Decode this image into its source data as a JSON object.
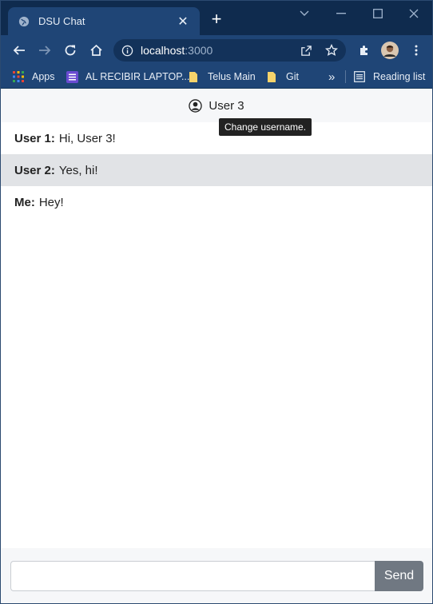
{
  "browser": {
    "tab": {
      "title": "DSU Chat",
      "close": "✕"
    },
    "new_tab": "+",
    "address": {
      "host": "localhost",
      "port": ":3000"
    },
    "bookmarks": [
      {
        "label": "Apps"
      },
      {
        "label": "AL RECIBIR LAPTOP..."
      },
      {
        "label": "Telus Main"
      },
      {
        "label": "Git"
      }
    ],
    "overflow": "»",
    "reading_list": "Reading list"
  },
  "header": {
    "username": "User 3",
    "tooltip": "Change username."
  },
  "messages": [
    {
      "sender": "User 1:",
      "text": "Hi, User 3!"
    },
    {
      "sender": "User 2:",
      "text": "Yes, hi!"
    },
    {
      "sender": "Me:",
      "text": "Hey!"
    }
  ],
  "composer": {
    "value": "",
    "send_label": "Send"
  },
  "colors": {
    "browser_frame": "#1f4576",
    "title_bar": "#0f2b4e",
    "alt_row": "#e1e3e6",
    "send_button": "#707882"
  }
}
